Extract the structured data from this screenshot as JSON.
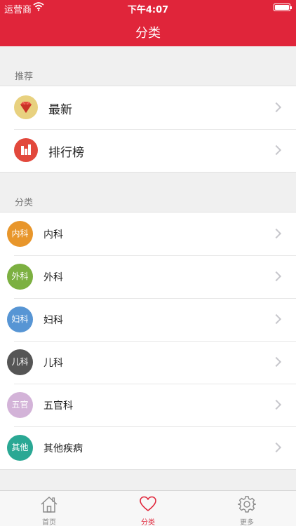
{
  "status_bar": {
    "carrier": "运营商",
    "time": "下午4:07",
    "battery_level": 1.0
  },
  "nav": {
    "title": "分类"
  },
  "recommend": {
    "header": "推荐",
    "items": [
      {
        "label": "最新",
        "icon": "gem-icon",
        "color": "#e8d17f"
      },
      {
        "label": "排行榜",
        "icon": "bar-chart-icon",
        "color": "#e2483c"
      }
    ]
  },
  "categories": {
    "header": "分类",
    "items": [
      {
        "badge": "内科",
        "label": "内科",
        "color": "#e8962b"
      },
      {
        "badge": "外科",
        "label": "外科",
        "color": "#7cb041"
      },
      {
        "badge": "妇科",
        "label": "妇科",
        "color": "#5795d4"
      },
      {
        "badge": "儿科",
        "label": "儿科",
        "color": "#555555"
      },
      {
        "badge": "五官",
        "label": "五官科",
        "color": "#d3b3d8"
      },
      {
        "badge": "其他",
        "label": "其他疾病",
        "color": "#2aa894"
      }
    ]
  },
  "tabbar": {
    "tabs": [
      {
        "label": "首页",
        "icon": "home-icon"
      },
      {
        "label": "分类",
        "icon": "heart-icon"
      },
      {
        "label": "更多",
        "icon": "gear-icon"
      }
    ],
    "active": 1
  },
  "accent_color": "#e0253a"
}
